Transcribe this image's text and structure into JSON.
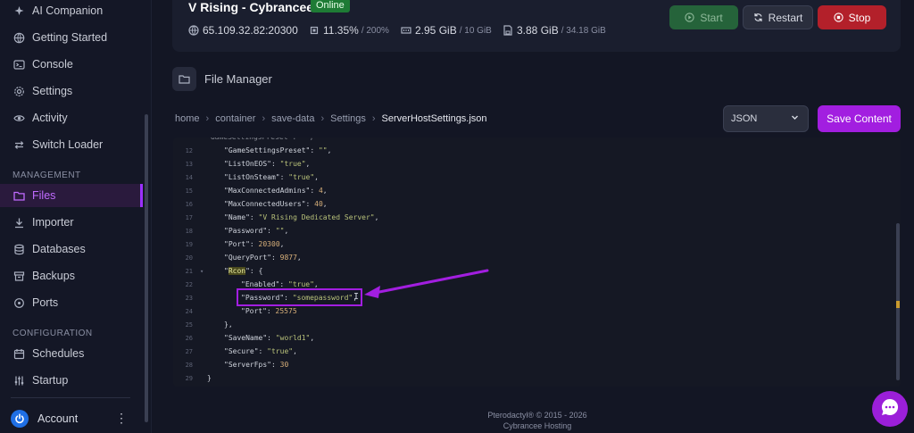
{
  "sidebar": {
    "items_top": [
      {
        "label": "AI Companion",
        "icon": "sparkle-icon"
      },
      {
        "label": "Getting Started",
        "icon": "globe-icon"
      },
      {
        "label": "Console",
        "icon": "terminal-icon"
      },
      {
        "label": "Settings",
        "icon": "gear-icon"
      },
      {
        "label": "Activity",
        "icon": "eye-icon"
      },
      {
        "label": "Switch Loader",
        "icon": "switch-icon"
      }
    ],
    "management_label": "MANAGEMENT",
    "items_management": [
      {
        "label": "Files",
        "icon": "folder-icon",
        "active": true
      },
      {
        "label": "Importer",
        "icon": "download-icon"
      },
      {
        "label": "Databases",
        "icon": "database-icon"
      },
      {
        "label": "Backups",
        "icon": "archive-icon"
      },
      {
        "label": "Ports",
        "icon": "network-icon"
      }
    ],
    "configuration_label": "CONFIGURATION",
    "items_configuration": [
      {
        "label": "Schedules",
        "icon": "calendar-icon"
      },
      {
        "label": "Startup",
        "icon": "sliders-icon"
      }
    ],
    "account_label": "Account"
  },
  "header": {
    "server_name": "V Rising - Cybrancee",
    "status": "Online",
    "ip": "65.109.32.82:20300",
    "cpu": "11.35%",
    "cpu_limit": "/ 200%",
    "memory": "2.95 GiB",
    "memory_limit": "/ 10 GiB",
    "disk": "3.88 GiB",
    "disk_limit": "/ 34.18 GiB",
    "start_label": "Start",
    "restart_label": "Restart",
    "stop_label": "Stop"
  },
  "file_manager": {
    "title": "File Manager",
    "breadcrumb": [
      "home",
      "container",
      "save-data",
      "Settings"
    ],
    "current_file": "ServerHostSettings.json",
    "language": "JSON",
    "save_label": "Save Content"
  },
  "editor": {
    "lines": [
      {
        "n": "12",
        "indent": 2,
        "key": "\"GameSettingsPreset\"",
        "value": "\"\"",
        "type": "s",
        "tail": ","
      },
      {
        "n": "13",
        "indent": 2,
        "key": "\"ListOnEOS\"",
        "value": "\"true\"",
        "type": "s",
        "tail": ","
      },
      {
        "n": "14",
        "indent": 2,
        "key": "\"ListOnSteam\"",
        "value": "\"true\"",
        "type": "s",
        "tail": ","
      },
      {
        "n": "15",
        "indent": 2,
        "key": "\"MaxConnectedAdmins\"",
        "value": "4",
        "type": "n",
        "tail": ","
      },
      {
        "n": "16",
        "indent": 2,
        "key": "\"MaxConnectedUsers\"",
        "value": "40",
        "type": "n",
        "tail": ","
      },
      {
        "n": "17",
        "indent": 2,
        "key": "\"Name\"",
        "value": "\"V Rising Dedicated Server\"",
        "type": "s",
        "tail": ","
      },
      {
        "n": "18",
        "indent": 2,
        "key": "\"Password\"",
        "value": "\"\"",
        "type": "s",
        "tail": ","
      },
      {
        "n": "19",
        "indent": 2,
        "key": "\"Port\"",
        "value": "20300",
        "type": "n",
        "tail": ","
      },
      {
        "n": "20",
        "indent": 2,
        "key": "\"QueryPort\"",
        "value": "9877",
        "type": "n",
        "tail": ","
      },
      {
        "n": "21",
        "indent": 2,
        "key": "\"Rcon\"",
        "value": "{",
        "type": "p",
        "tail": "",
        "highlight": "Rcon"
      },
      {
        "n": "22",
        "indent": 4,
        "key": "\"Enabled\"",
        "value": "\"true\"",
        "type": "s",
        "tail": ","
      },
      {
        "n": "23",
        "indent": 4,
        "key": "\"Password\"",
        "value": "\"somepassword\"",
        "type": "s",
        "tail": ","
      },
      {
        "n": "24",
        "indent": 4,
        "key": "\"Port\"",
        "value": "25575",
        "type": "n",
        "tail": ""
      },
      {
        "n": "25",
        "indent": 2,
        "key": "",
        "value": "},",
        "type": "p",
        "tail": ""
      },
      {
        "n": "26",
        "indent": 2,
        "key": "\"SaveName\"",
        "value": "\"world1\"",
        "type": "s",
        "tail": ","
      },
      {
        "n": "27",
        "indent": 2,
        "key": "\"Secure\"",
        "value": "\"true\"",
        "type": "s",
        "tail": ","
      },
      {
        "n": "28",
        "indent": 2,
        "key": "\"ServerFps\"",
        "value": "30",
        "type": "n",
        "tail": ""
      },
      {
        "n": "29",
        "indent": 0,
        "key": "",
        "value": "}",
        "type": "p",
        "tail": ""
      }
    ]
  },
  "footer": {
    "line1": "Pterodactyl® © 2015 - 2026",
    "line2": "Cybrancee Hosting"
  },
  "colors": {
    "accent": "#a21ee0",
    "online": "#1e7b35",
    "stop": "#b3202a",
    "start": "#25633a"
  }
}
